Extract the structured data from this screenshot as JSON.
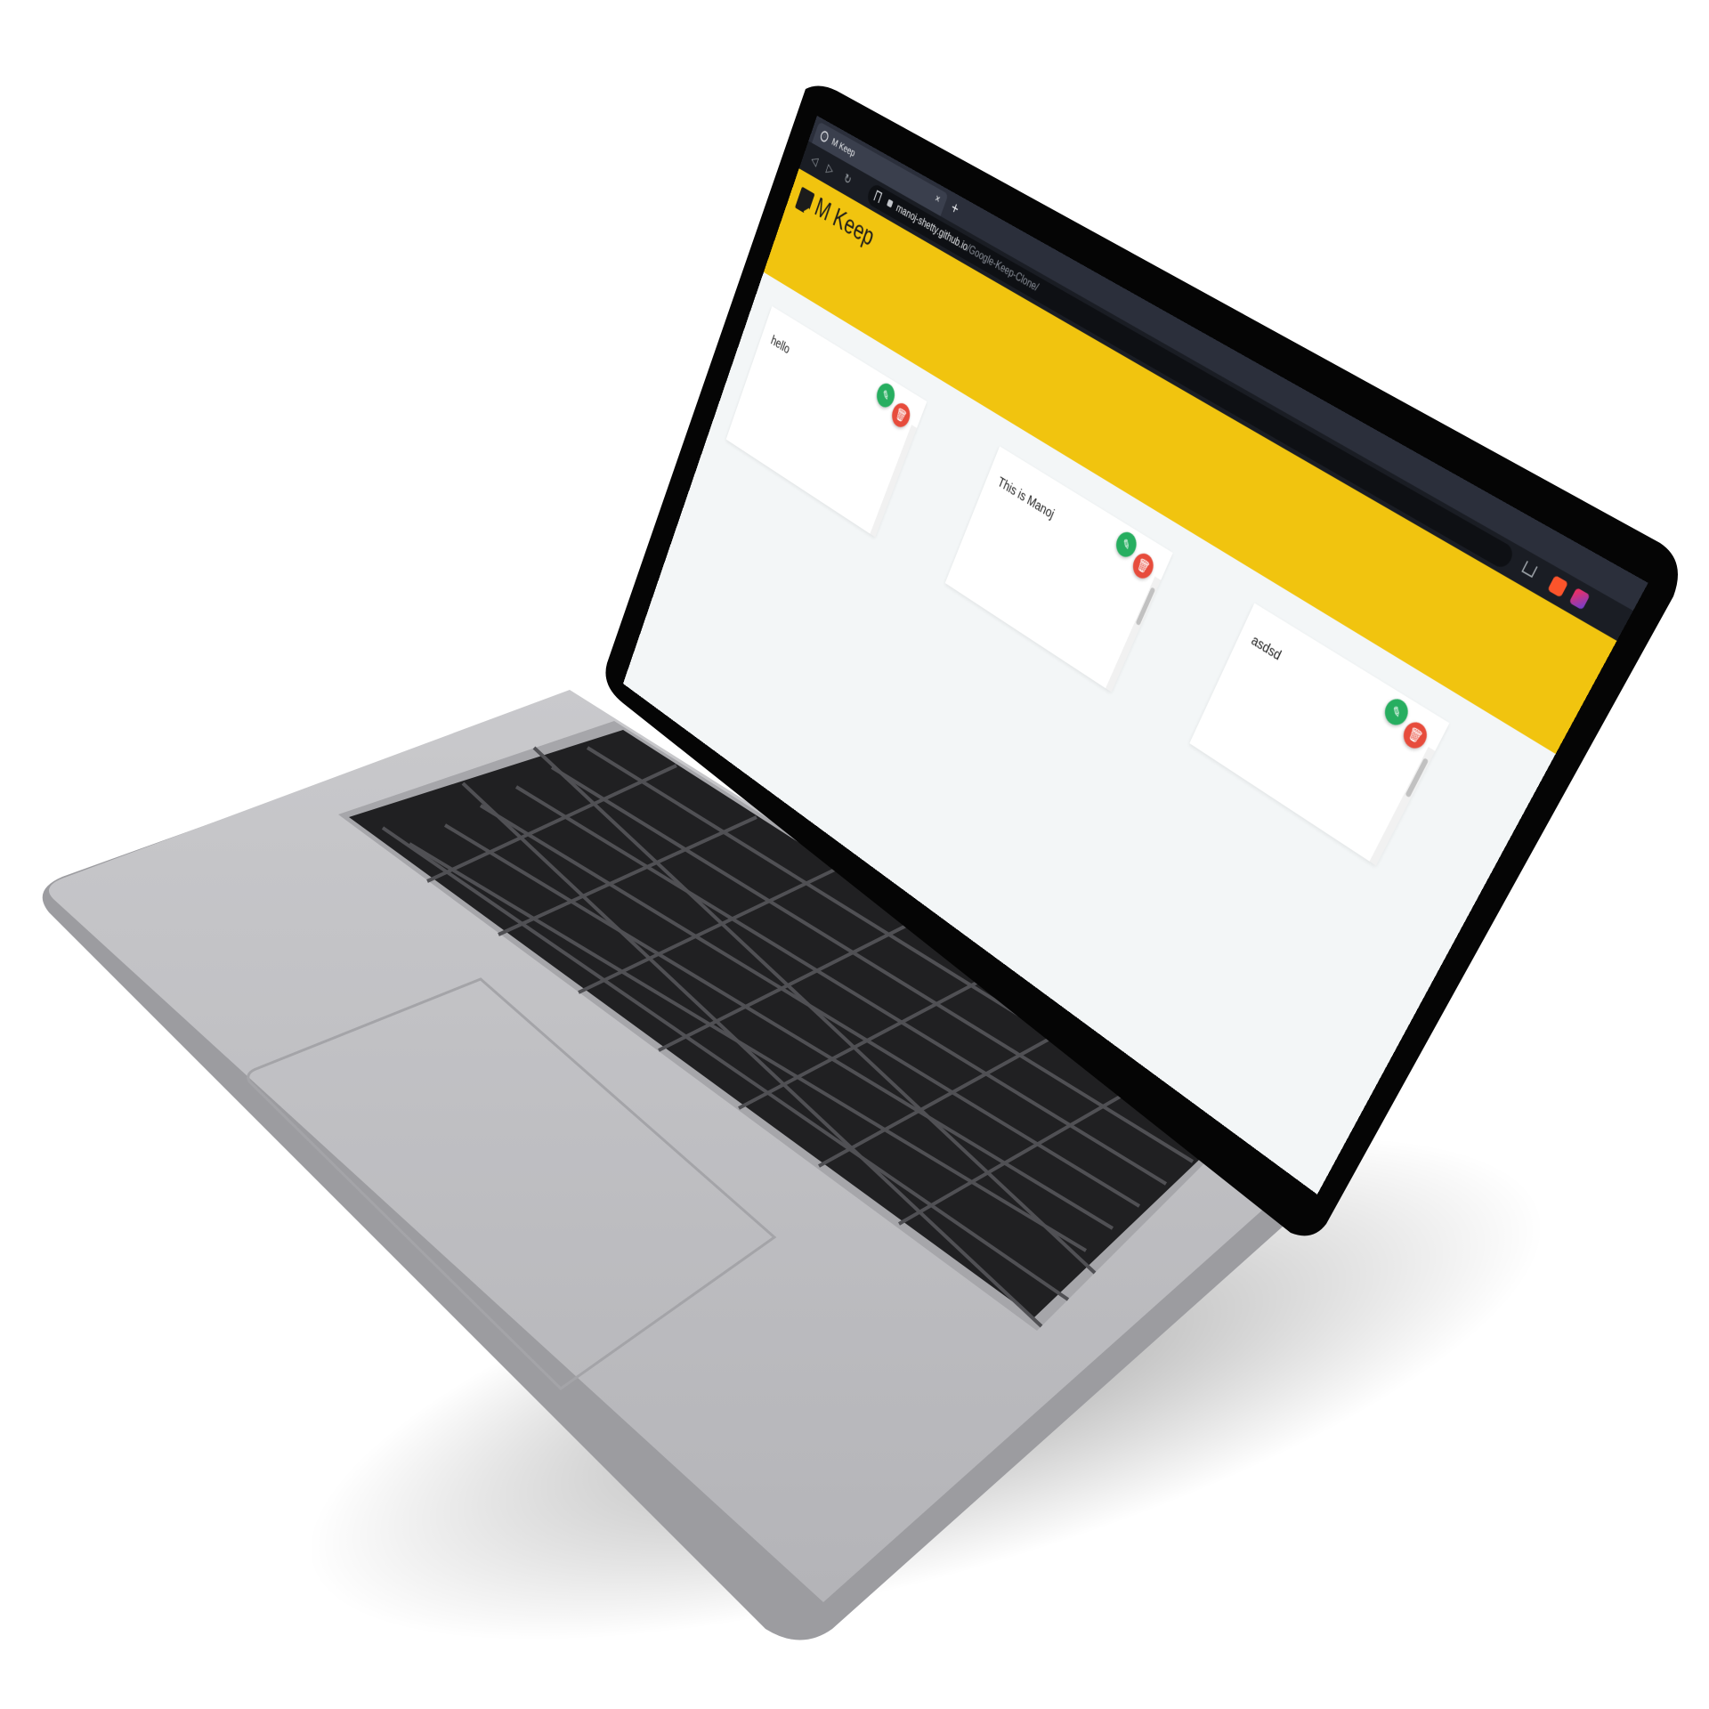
{
  "browser": {
    "tab_title": "M Keep",
    "tab_close": "×",
    "new_tab": "+",
    "nav_back": "◁",
    "nav_forward": "▷",
    "nav_reload": "↻",
    "url_host": "manoj-shetty.github.io",
    "url_path": "/Google-Keep-Clone/",
    "extensions": [
      "brave-shields-icon",
      "brave-rewards-icon"
    ]
  },
  "app": {
    "title": "M Keep",
    "accent_color": "#f1c40f"
  },
  "notes": [
    {
      "text": "hello"
    },
    {
      "text": "This is Manoj"
    },
    {
      "text": "asdsd"
    }
  ],
  "note_actions": {
    "edit_icon": "✎",
    "delete_icon": "🗑",
    "edit_color": "#27ae60",
    "delete_color": "#e74c3c"
  }
}
